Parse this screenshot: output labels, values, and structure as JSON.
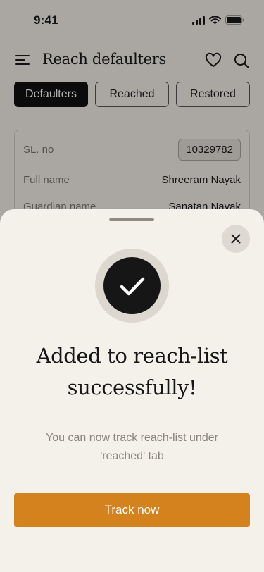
{
  "status_bar": {
    "time": "9:41",
    "icons": [
      "signal-icon",
      "wifi-icon",
      "battery-icon"
    ]
  },
  "header": {
    "title": "Reach defaulters",
    "icons": [
      "menu-icon",
      "heart-icon",
      "search-icon"
    ]
  },
  "tabs": [
    {
      "label": "Defaulters",
      "active": true
    },
    {
      "label": "Reached",
      "active": false
    },
    {
      "label": "Restored",
      "active": false
    }
  ],
  "record": {
    "fields": [
      {
        "label": "SL. no",
        "value": "10329782"
      },
      {
        "label": "Full name",
        "value": "Shreeram Nayak"
      },
      {
        "label": "Guardian name",
        "value": "Sanatan Nayak"
      }
    ]
  },
  "sheet": {
    "title_line_1": "Added to reach-list",
    "title_line_2": "successfully!",
    "subtitle_line_1": "You can now track reach-list under",
    "subtitle_line_2": "'reached' tab",
    "button_label": "Track now",
    "icons": [
      "close-icon",
      "check-icon"
    ]
  },
  "colors": {
    "background": "#f4f0ea",
    "accent": "#d4821d",
    "active_tab": "#111111",
    "muted_text": "#8a857d"
  }
}
